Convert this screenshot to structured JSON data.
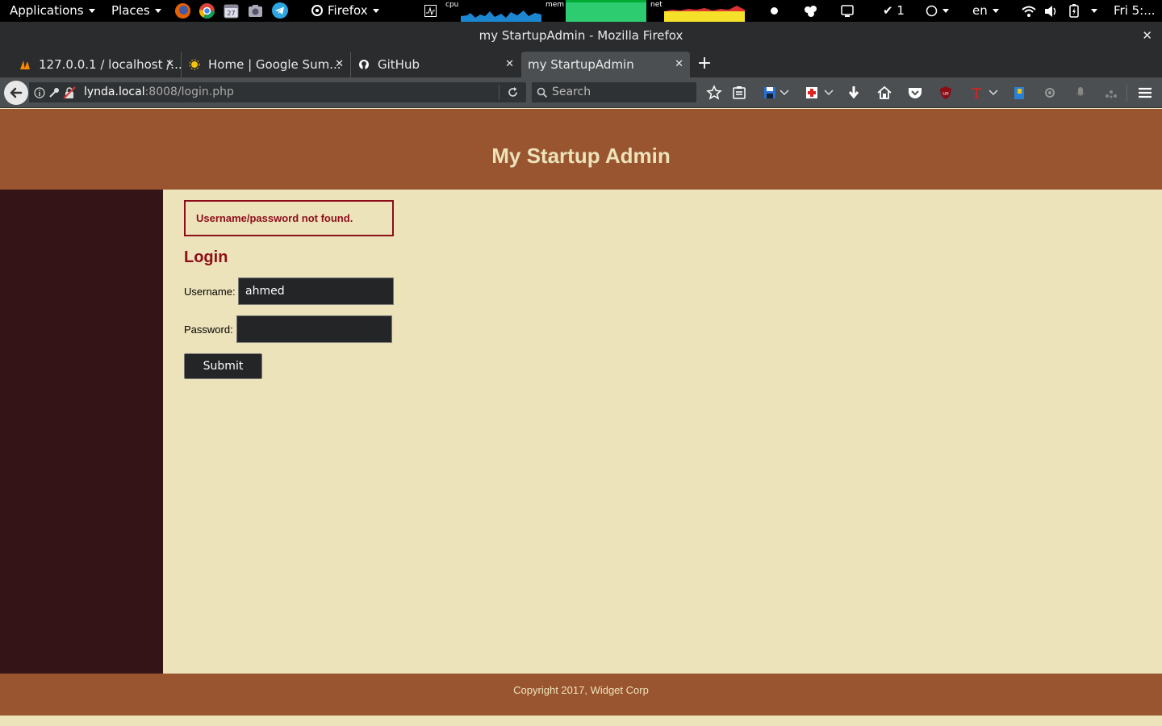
{
  "panel": {
    "applications": "Applications",
    "places": "Places",
    "firefox": "Firefox",
    "cpu_label": "cpu",
    "mem_label": "mem",
    "net_label": "net",
    "updates_count": "1",
    "language": "en",
    "clock": "Fri 5:..."
  },
  "window": {
    "title": "my StartupAdmin - Mozilla Firefox"
  },
  "tabs": [
    {
      "label": "127.0.0.1 / localhost /..."
    },
    {
      "label": "Home | Google Sum..."
    },
    {
      "label": "GitHub"
    },
    {
      "label": "my StartupAdmin"
    }
  ],
  "navbar": {
    "url_host": "lynda.local",
    "url_rest": ":8008/login.php",
    "search_placeholder": "Search"
  },
  "page": {
    "site_title": "My Startup Admin",
    "error_message": "Username/password not found.",
    "login_heading": "Login",
    "username_label": "Username:",
    "username_value": "ahmed",
    "password_label": "Password:",
    "password_value": "",
    "submit_label": "Submit",
    "copyright": "Copyright 2017, Widget Corp"
  },
  "colors": {
    "header_brown": "#995530",
    "sidebar_dark": "#351418",
    "content_cream": "#ede3bb",
    "error_red": "#8d0d19"
  }
}
